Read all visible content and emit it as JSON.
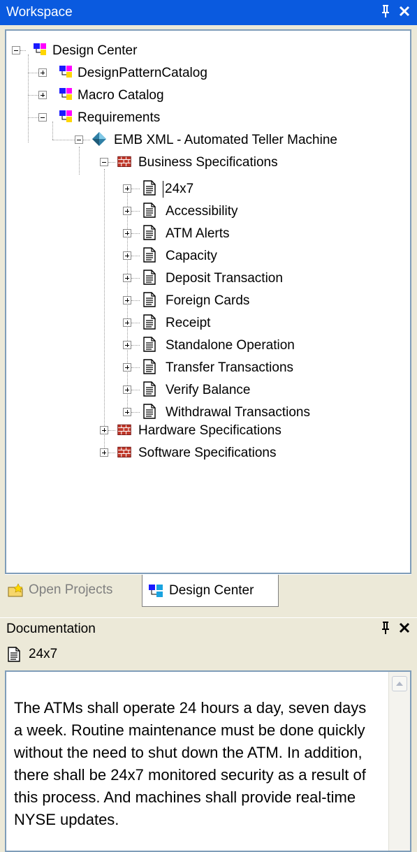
{
  "workspace": {
    "title": "Workspace",
    "pin_glyph": "p",
    "close_glyph": "✕"
  },
  "tree": {
    "root": "Design Center",
    "catalogs": [
      "DesignPatternCatalog",
      "Macro Catalog",
      "Requirements"
    ],
    "model": "EMB XML - Automated Teller Machine",
    "business": "Business Specifications",
    "requirements": [
      "24x7",
      "Accessibility",
      "ATM Alerts",
      "Capacity",
      "Deposit Transaction",
      "Foreign Cards",
      "Receipt",
      "Standalone Operation",
      "Transfer Transactions",
      "Verify Balance",
      "Withdrawal Transactions"
    ],
    "hardware": "Hardware Specifications",
    "software": "Software Specifications",
    "selected": "24x7"
  },
  "tabs": {
    "open_projects": "Open Projects",
    "design_center": "Design Center"
  },
  "documentation": {
    "title": "Documentation",
    "item": "24x7",
    "text": "The ATMs shall operate 24 hours a day, seven days a week. Routine maintenance must be done quickly without the need to shut down the ATM. In addition, there shall be 24x7 monitored security as a result of this process. And machines shall provide real-time NYSE updates."
  },
  "colors": {
    "titlebar": "#0a5adf",
    "panel_bg": "#ece9d8",
    "border": "#7f9db9"
  },
  "icons": {
    "folder_catalog": "catalog-icon",
    "model": "model-diamond-icon",
    "spec_group": "specification-bricks-icon",
    "requirement": "document-icon",
    "pin": "pin-icon",
    "close": "close-icon",
    "open_projects": "open-folder-icon",
    "design_center": "design-center-icon"
  }
}
